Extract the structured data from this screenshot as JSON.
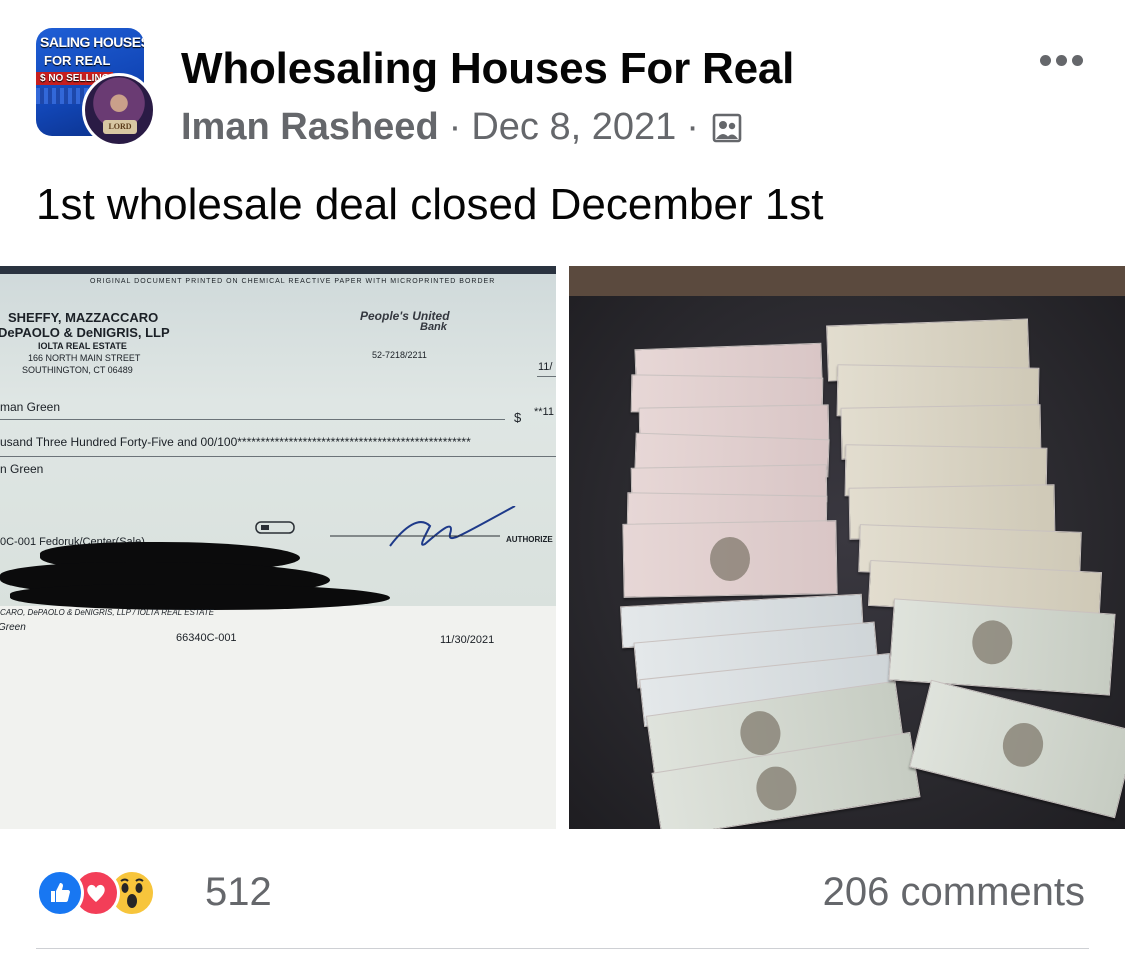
{
  "post": {
    "group_name": "Wholesaling Houses For Real",
    "author": "Iman Rasheed",
    "separator": "·",
    "date": "Dec 8, 2021",
    "audience_icon": "members-icon",
    "text": "1st wholesale deal closed December 1st",
    "more_icon": "more-options-icon"
  },
  "group_avatar": {
    "line1": "SALING HOUSES",
    "line2": "FOR REAL",
    "line3": "$ NO SELLING",
    "badge": "LORD"
  },
  "check": {
    "border_text": "ORIGINAL DOCUMENT PRINTED ON CHEMICAL REACTIVE PAPER WITH MICROPRINTED BORDER",
    "firm_line1": "SHEFFY, MAZZACCARO",
    "firm_line2": "DePAOLO & DeNIGRIS, LLP",
    "iolta": "IOLTA REAL ESTATE",
    "address1": "166 NORTH MAIN STREET",
    "address2": "SOUTHINGTON, CT 06489",
    "bank_line1": "People's United",
    "bank_line2": "Bank",
    "routing": "52-7218/2211",
    "date_fragment": "11/",
    "payee": "man Green",
    "dollar_sign": "$",
    "amount_fragment": "**11",
    "amount_words": "usand Three Hundred Forty-Five and 00/100**************************************************",
    "name_line": "n Green",
    "memo": "0C-001 Fedoruk/Center(Sale)",
    "authorized": "AUTHORIZE",
    "stub_firm": "CARO, DePAOLO & DeNIGRIS, LLP / IOLTA REAL ESTATE",
    "stub_name": "Green",
    "stub_number": "66340C-001",
    "stub_date": "11/30/2021"
  },
  "reactions": {
    "icons": [
      "like-icon",
      "love-icon",
      "wow-icon"
    ],
    "count": "512",
    "comments": "206 comments"
  },
  "colors": {
    "like": "#1877f2",
    "love": "#f33e58",
    "wow": "#f7c53c",
    "secondary_text": "#65676b"
  }
}
